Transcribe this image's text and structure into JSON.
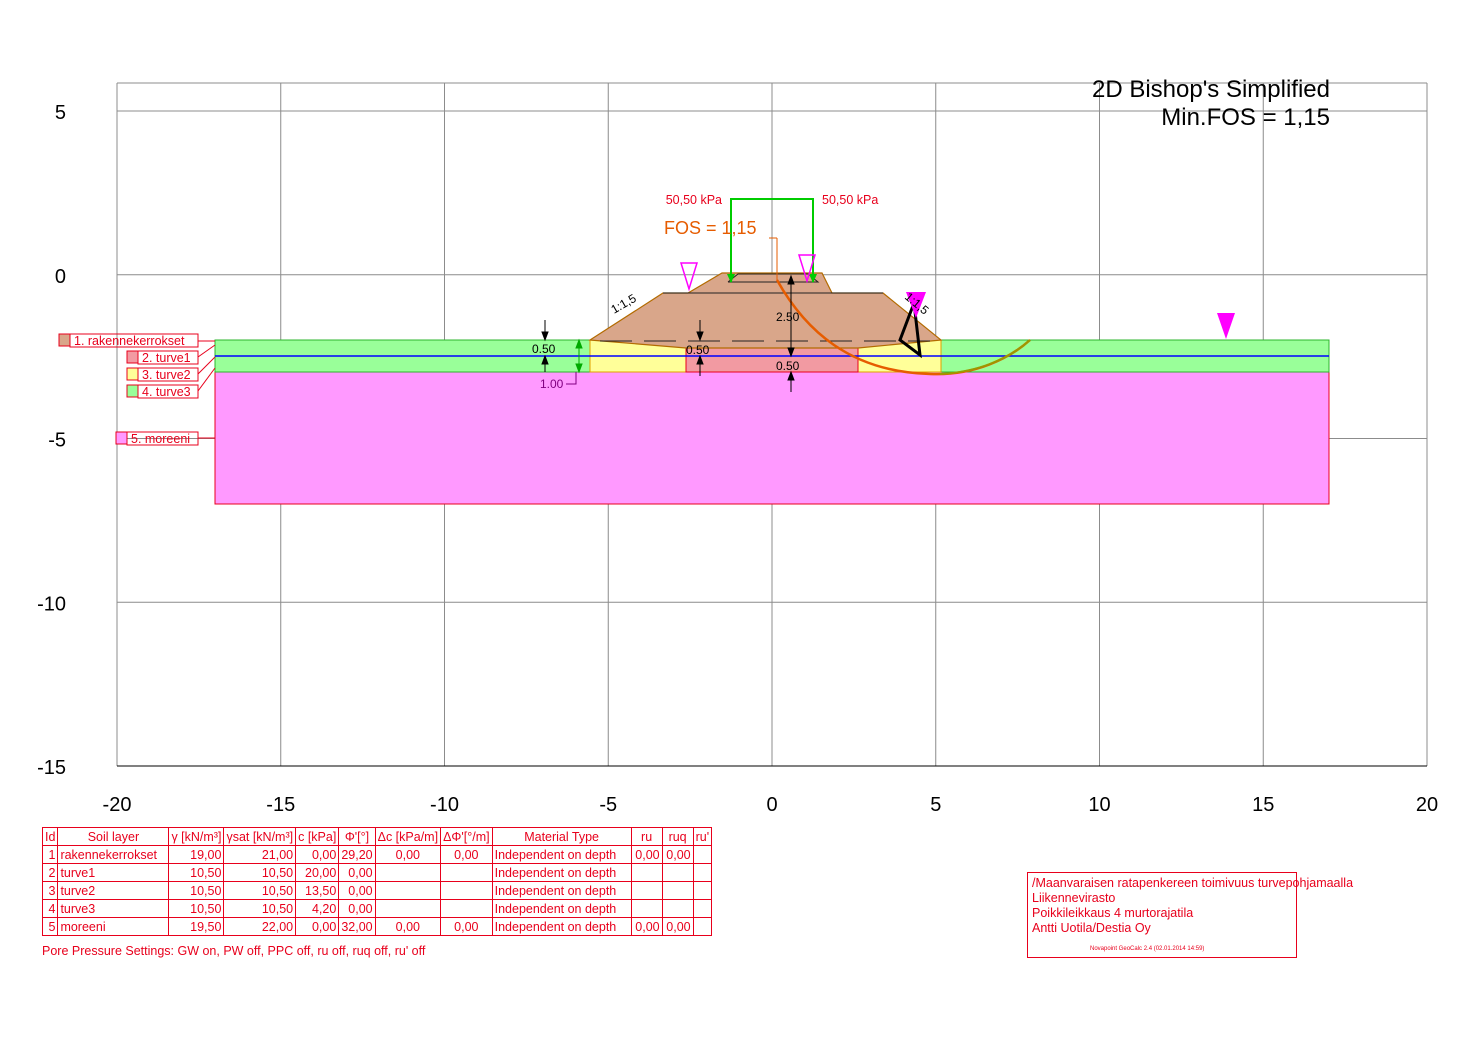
{
  "title": {
    "line1": "2D Bishop's Simplified",
    "line2": "Min.FOS = 1,15"
  },
  "plot": {
    "x_ticks": [
      "-20",
      "-15",
      "-10",
      "-5",
      "0",
      "5",
      "10",
      "15",
      "20"
    ],
    "y_ticks": [
      "5",
      "0",
      "-5",
      "-10",
      "-15"
    ],
    "x_range": [
      -20,
      20
    ],
    "y_range": [
      -15,
      5
    ]
  },
  "annotations": {
    "load_left": "50,50 kPa",
    "load_right": "50,50 kPa",
    "fos": "FOS = 1,15",
    "slope_left": "1:1,5",
    "slope_right": "1:1,5",
    "dim_050_left": "0.50",
    "dim_100_left": "1.00",
    "dim_050_center_upper": "0.50",
    "dim_250": "2.50",
    "dim_050_center_lower": "0.50"
  },
  "layer_labels": [
    {
      "label": "1. rakennekerrokset",
      "color": "#d9a68a"
    },
    {
      "label": "2. turve1",
      "color": "#f29aa2"
    },
    {
      "label": "3. turve2",
      "color": "#ffff99"
    },
    {
      "label": "4. turve3",
      "color": "#99ff99"
    },
    {
      "label": "5. moreeni",
      "color": "#ff99ff"
    }
  ],
  "colors": {
    "fill": "#d9a68a",
    "turve1": "#f29aa2",
    "turve2": "#ffff99",
    "turve3": "#99ff99",
    "moreeni": "#ff99ff",
    "water": "#0000ff",
    "slip": "#e65c00",
    "load": "#00cc00",
    "text_red": "#e8001c",
    "marker": "#ff00ff"
  },
  "table": {
    "headers": [
      "Id",
      "Soil layer",
      "γ [kN/m³]",
      "γsat [kN/m³]",
      "c [kPa]",
      "Φ'[°]",
      "Δc [kPa/m]",
      "ΔΦ'[°/m]",
      "Material Type",
      "ru",
      "ruq",
      "ru'"
    ],
    "rows": [
      [
        "1",
        "rakennekerrokset",
        "19,00",
        "21,00",
        "0,00",
        "29,20",
        "0,00",
        "0,00",
        "Independent on depth",
        "0,00",
        "0,00",
        ""
      ],
      [
        "2",
        "turve1",
        "10,50",
        "10,50",
        "20,00",
        "0,00",
        "",
        "",
        "Independent on depth",
        "",
        "",
        ""
      ],
      [
        "3",
        "turve2",
        "10,50",
        "10,50",
        "13,50",
        "0,00",
        "",
        "",
        "Independent on depth",
        "",
        "",
        ""
      ],
      [
        "4",
        "turve3",
        "10,50",
        "10,50",
        "4,20",
        "0,00",
        "",
        "",
        "Independent on depth",
        "",
        "",
        ""
      ],
      [
        "5",
        "moreeni",
        "19,50",
        "22,00",
        "0,00",
        "32,00",
        "0,00",
        "0,00",
        "Independent on depth",
        "0,00",
        "0,00",
        ""
      ]
    ]
  },
  "pore_pressure": "Pore Pressure Settings: GW on, PW off, PPC off, ru off, ruq off, ru' off",
  "info": {
    "line1": "/Maanvaraisen ratapenkereen toimivuus turvepohjamaalla",
    "line2": "Liikennevirasto",
    "line3": "Poikkileikkaus 4 murtorajatila",
    "line4": "Antti Uotila/Destia Oy",
    "software": "Novapoint GeoCalc 2.4  (02.01.2014 14:59)"
  }
}
